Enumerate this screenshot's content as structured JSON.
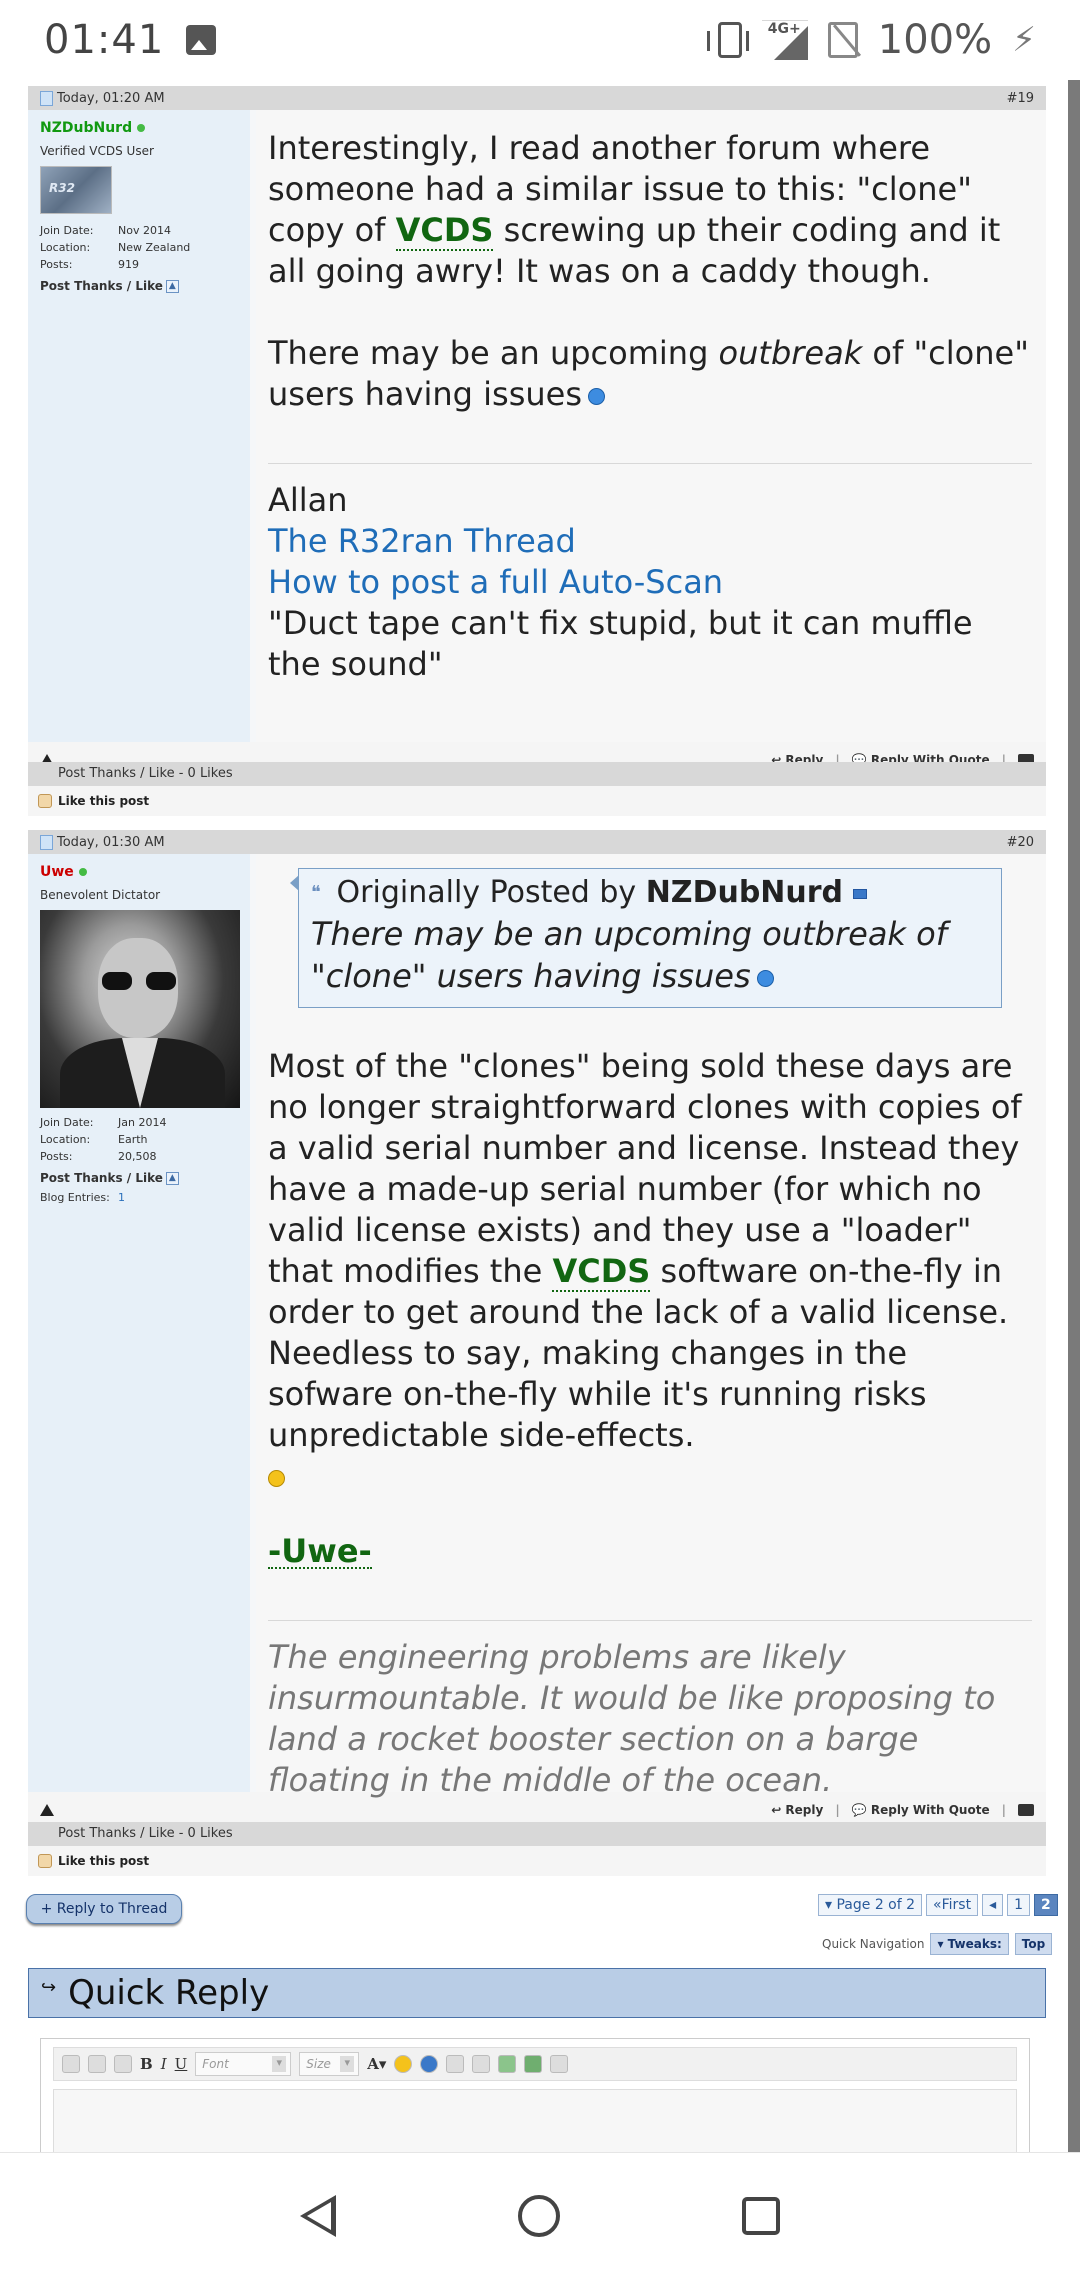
{
  "status_bar": {
    "time": "01:41",
    "network": "4G+",
    "battery": "100%"
  },
  "post19": {
    "date": "Today, 01:20 AM",
    "number": "#19",
    "username": "NZDubNurd",
    "user_title": "Verified VCDS User",
    "avatar_text": "R32",
    "join_date_label": "Join Date:",
    "join_date": "Nov 2014",
    "location_label": "Location:",
    "location": "New Zealand",
    "posts_label": "Posts:",
    "posts": "919",
    "thanks_link": "Post Thanks / Like",
    "body_p1_a": "Interestingly, I read another forum where someone had a similar issue to this: \"clone\" copy of ",
    "body_p1_vcds": "VCDS",
    "body_p1_b": " screwing up their coding and it all going awry! It was on a caddy though.",
    "body_p2_a": "There may be an upcoming ",
    "body_p2_em": "outbreak",
    "body_p2_b": " of \"clone\" users having issues",
    "sig_name": "Allan",
    "sig_link1": "The R32ran Thread",
    "sig_link2": "How to post a full Auto-Scan",
    "sig_quote": "\"Duct tape can't fix stupid, but it can muffle the sound\"",
    "reply": "Reply",
    "reply_quote": "Reply With Quote",
    "thanks_header": "Post Thanks / Like - 0 Likes",
    "like_this": "Like this post"
  },
  "post20": {
    "date": "Today, 01:30 AM",
    "number": "#20",
    "username": "Uwe",
    "user_title": "Benevolent Dictator",
    "join_date_label": "Join Date:",
    "join_date": "Jan 2014",
    "location_label": "Location:",
    "location": "Earth",
    "posts_label": "Posts:",
    "posts": "20,508",
    "thanks_link": "Post Thanks / Like",
    "blog_label": "Blog Entries:",
    "blog_count": "1",
    "quote_prefix": "Originally Posted by ",
    "quote_author": "NZDubNurd",
    "quote_text": "There may be an upcoming outbreak of \"clone\" users having issues",
    "body_a": "Most of the \"clones\" being sold these days are no longer straightforward clones with copies of a valid serial number and license. Instead they have a made-up serial number (for which no valid license exists) and they use a \"loader\" that modifies the ",
    "body_vcds": "VCDS",
    "body_b": " software on-the-fly in order to get around the lack of a valid license. Needless to say, making changes in the sofware on-the-fly while it's running risks unpredictable side-effects.",
    "sign": "-Uwe-",
    "sig_text": "The engineering problems are likely insurmountable. It would be like proposing to land a rocket booster section on a barge floating in the middle of the ocean.",
    "reply": "Reply",
    "reply_quote": "Reply With Quote",
    "thanks_header": "Post Thanks / Like - 0 Likes",
    "like_this": "Like this post"
  },
  "bottom": {
    "reply_thread": "+ Reply to Thread",
    "page_of": "Page 2 of 2",
    "first": "First",
    "prev": "◂",
    "page1": "1",
    "page2": "2",
    "quick_nav": "Quick Navigation",
    "tweaks": "Tweaks:",
    "top": "Top",
    "quick_reply": "Quick Reply",
    "font_placeholder": "Font",
    "size_placeholder": "Size"
  },
  "colors": {
    "accent": "#1f6db8",
    "vcds_green": "#116611",
    "user_red": "#cc0000",
    "header_blue": "#b9cde6"
  }
}
